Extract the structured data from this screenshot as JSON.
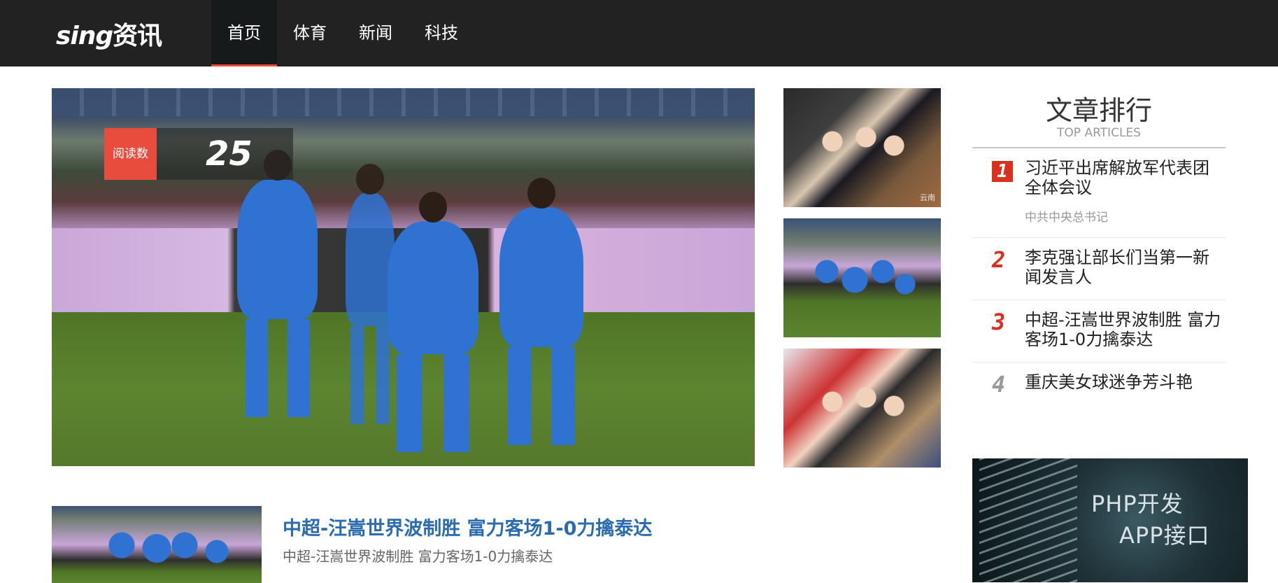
{
  "header": {
    "logo_latin": "sing",
    "logo_cn": "资讯",
    "nav": [
      {
        "label": "首页",
        "active": true
      },
      {
        "label": "体育",
        "active": false
      },
      {
        "label": "新闻",
        "active": false
      },
      {
        "label": "科技",
        "active": false
      }
    ]
  },
  "hero": {
    "read_label": "阅读数",
    "read_count": "25"
  },
  "thumbs": {
    "watermark": "云南"
  },
  "sidebar": {
    "title": "文章排行",
    "subtitle": "TOP ARTICLES",
    "items": [
      {
        "rank": "1",
        "title": "习近平出席解放军代表团全体会议",
        "sub": "中共中央总书记"
      },
      {
        "rank": "2",
        "title": "李克强让部长们当第一新闻发言人"
      },
      {
        "rank": "3",
        "title": "中超-汪嵩世界波制胜 富力客场1-0力擒泰达"
      },
      {
        "rank": "4",
        "title": "重庆美女球迷争芳斗艳"
      }
    ]
  },
  "ad": {
    "line1": "PHP开发",
    "line2": "APP接口"
  },
  "article": {
    "title": "中超-汪嵩世界波制胜 富力客场1-0力擒泰达",
    "summary": "中超-汪嵩世界波制胜 富力客场1-0力擒泰达"
  },
  "colors": {
    "accent": "#e74c3c",
    "topbar": "#222222",
    "link": "#2b6cb0"
  }
}
